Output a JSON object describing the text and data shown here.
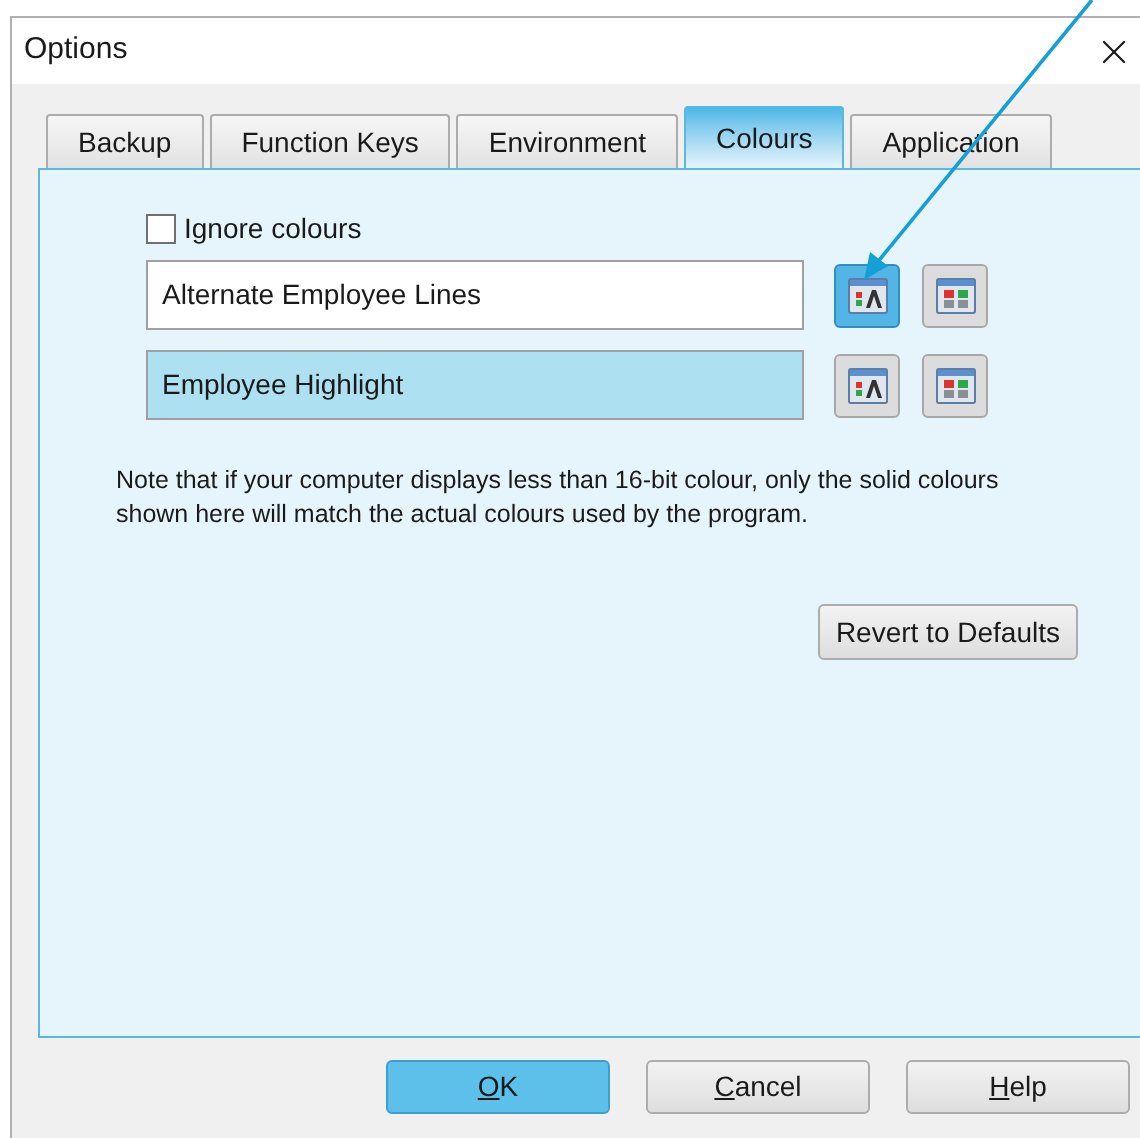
{
  "window": {
    "title": "Options"
  },
  "tabs": [
    {
      "label": "Backup",
      "selected": false
    },
    {
      "label": "Function Keys",
      "selected": false
    },
    {
      "label": "Environment",
      "selected": false
    },
    {
      "label": "Colours",
      "selected": true
    },
    {
      "label": "Application",
      "selected": false
    }
  ],
  "ignore_colours": {
    "label": "Ignore colours",
    "checked": false
  },
  "colour_rows": [
    {
      "label": "Alternate Employee Lines",
      "color": "#ffffff",
      "text_button_highlighted": true,
      "background_button_highlighted": false
    },
    {
      "label": "Employee Highlight",
      "color": "#ade0f0",
      "text_button_highlighted": false,
      "background_button_highlighted": false
    }
  ],
  "note": "Note that if your computer displays less than 16-bit colour, only the solid colours shown here will match the actual colours used by the program.",
  "revert_button": "Revert to Defaults",
  "buttons": [
    {
      "access_key": "O",
      "label_rest": "K",
      "default": true
    },
    {
      "access_key": "C",
      "label_rest": "ancel",
      "default": false
    },
    {
      "access_key": "H",
      "label_rest": "elp",
      "default": false
    }
  ]
}
